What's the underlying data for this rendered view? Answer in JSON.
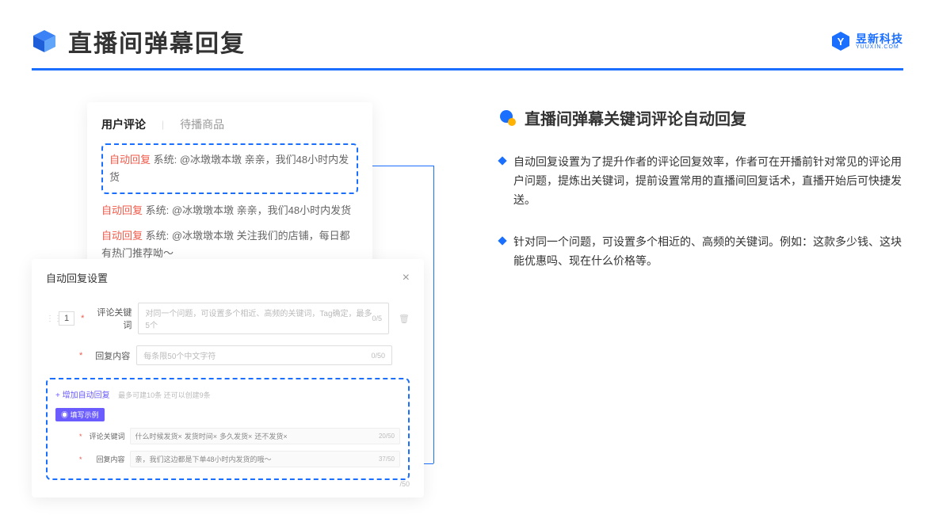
{
  "header": {
    "title": "直播间弹幕回复"
  },
  "logo": {
    "cn": "昱新科技",
    "en": "YUUXIN.COM"
  },
  "comments_card": {
    "tab_active": "用户评论",
    "tab_inactive": "待播商品",
    "row1_badge": "自动回复",
    "row1_text": " 系统: @冰墩墩本墩 亲亲，我们48小时内发货",
    "row2_badge": "自动回复",
    "row2_text": " 系统: @冰墩墩本墩 亲亲，我们48小时内发货",
    "row3_badge": "自动回复",
    "row3_text": " 系统: @冰墩墩本墩 关注我们的店铺，每日都有热门推荐呦～"
  },
  "settings_card": {
    "title": "自动回复设置",
    "num": "1",
    "label_keyword": "评论关键词",
    "placeholder_keyword": "对同一个问题，可设置多个相近、高频的关键词，Tag确定，最多5个",
    "count_keyword": "0/5",
    "label_content": "回复内容",
    "placeholder_content": "每条限50个中文字符",
    "count_content": "0/50",
    "add_link": "+ 增加自动回复",
    "add_hint": "最多可建10条 还可以创建9条",
    "example_tag": "◉ 填写示例",
    "ex_label_kw": "评论关键词",
    "ex_kw_tags": [
      "什么时候发货×",
      "发货时间×",
      "多久发货×",
      "还不发货×"
    ],
    "ex_kw_count": "20/50",
    "ex_label_ct": "回复内容",
    "ex_ct_text": "亲，我们这边都是下单48小时内发货的哦～",
    "ex_ct_count": "37/50",
    "stray_count": "/50"
  },
  "right": {
    "section_title": "直播间弹幕关键词评论自动回复",
    "bullet1": "自动回复设置为了提升作者的评论回复效率，作者可在开播前针对常见的评论用户问题，提炼出关键词，提前设置常用的直播间回复话术，直播开始后可快捷发送。",
    "bullet2": "针对同一个问题，可设置多个相近的、高频的关键词。例如：这款多少钱、这块能优惠吗、现在什么价格等。"
  }
}
